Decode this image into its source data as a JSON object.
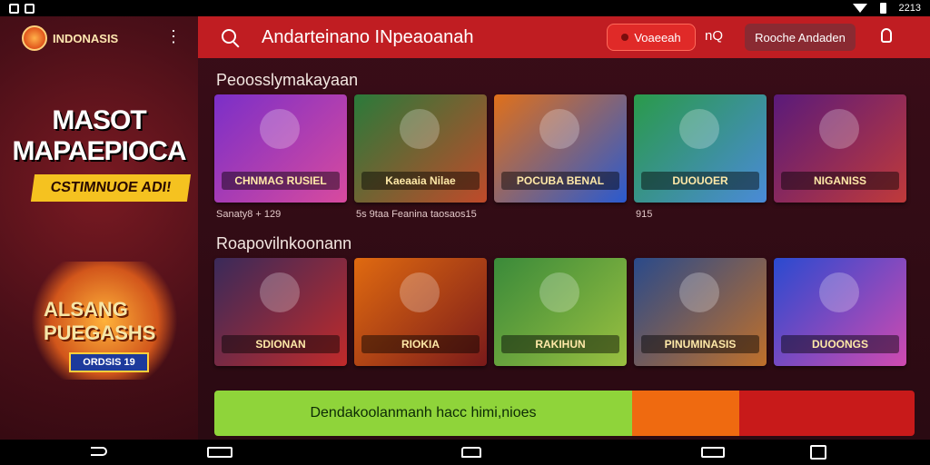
{
  "status_bar": {
    "time": "2213"
  },
  "sidebar": {
    "brand_name": "INDONASIS",
    "promo_title_line1": "MASOT",
    "promo_title_line2": "MAPAEPIOCA",
    "promo_ribbon": "CSTIMNUOE ADI!",
    "promo2_line1": "ALSANG",
    "promo2_line2": "PUEGASHS",
    "promo2_badge": "ORDSIS 19"
  },
  "header": {
    "title": "Andarteinano INpeaoanah",
    "pill_button": "Voaeeah",
    "link": "nQ",
    "button": "Rooche Andaden"
  },
  "sections": [
    {
      "title": "Peoosslymakayaan",
      "cards": [
        {
          "label": "CHNMAG RUSIEL",
          "color1": "#7b2fc8",
          "color2": "#d84a9e"
        },
        {
          "label": "Kaeaaia Nilae",
          "color1": "#2a7a3a",
          "color2": "#c04a2a"
        },
        {
          "label": "POCUBA BENAL",
          "color1": "#e0701a",
          "color2": "#2a5ad0"
        },
        {
          "label": "DUOUOER",
          "color1": "#2a9a4a",
          "color2": "#4a8ad8"
        },
        {
          "label": "NIGANISS",
          "color1": "#5a1a7a",
          "color2": "#c03a3a"
        }
      ],
      "captions": [
        "Sanaty8 + 129",
        "5s 9taa Feanina taosaos15",
        "915"
      ]
    },
    {
      "title": "Roapovilnkoonann",
      "cards": [
        {
          "label": "SDIONAN",
          "color1": "#3a2a5a",
          "color2": "#c02a2a"
        },
        {
          "label": "RIOKIA",
          "color1": "#e06a10",
          "color2": "#7a1a1a"
        },
        {
          "label": "RAKIHUN",
          "color1": "#3a8a3a",
          "color2": "#9ac040"
        },
        {
          "label": "PINUMINASIS",
          "color1": "#2a4a8a",
          "color2": "#c0702a"
        },
        {
          "label": "DUOONGS",
          "color1": "#2a4ad0",
          "color2": "#d04ab0"
        }
      ],
      "captions": []
    }
  ],
  "banner": {
    "text": "Dendakoolanmanh hacc himi,nioes"
  }
}
